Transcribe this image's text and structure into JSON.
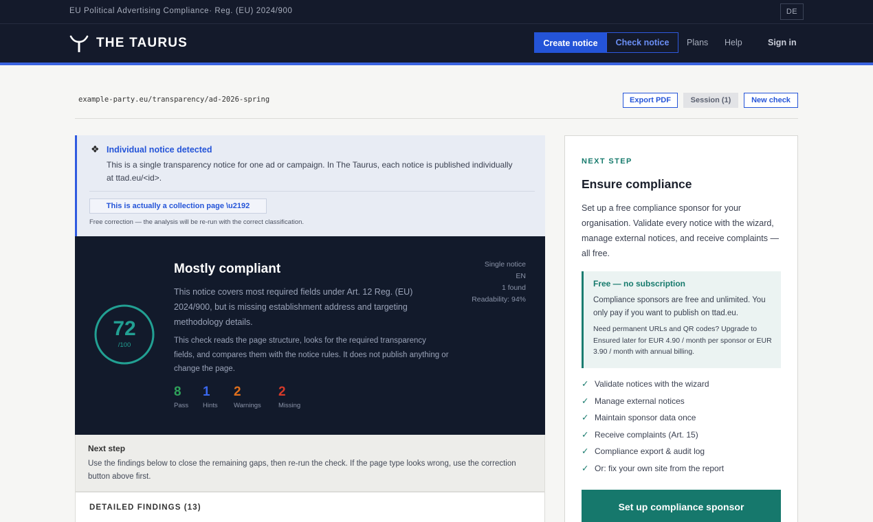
{
  "topbar": {
    "regulation_text": "EU Political Advertising Compliance· Reg. (EU) 2024/900",
    "language": "DE"
  },
  "header": {
    "brand": "THE TAURUS",
    "logo_icon": "taurus-horns-icon",
    "create_notice": "Create notice",
    "check_notice": "Check notice",
    "nav": {
      "plans": "Plans",
      "help": "Help",
      "sign_in": "Sign in"
    },
    "accent_color": "#3a63e0"
  },
  "toolbar": {
    "url": "example-party.eu/transparency/ad-2026-spring",
    "export_pdf": "Export PDF",
    "session": "Session (1)",
    "new_check": "New check"
  },
  "detection": {
    "icon": "four-diamonds-icon",
    "title": "Individual notice detected",
    "description": "This is a single transparency notice for one ad or campaign. In The Taurus, each notice is published individually at ttad.eu/<id>.",
    "correction_button": "This is actually a collection page \\u2192",
    "correction_note": "Free correction — the analysis will be re-run with the correct classification."
  },
  "score": {
    "value": "72",
    "max": "/100",
    "fraction": 0.72,
    "color": "#22a093",
    "heading": "Mostly compliant",
    "summary": "This notice covers most required fields under Art. 12 Reg. (EU) 2024/900, but is missing establishment address and targeting methodology details.",
    "explanation": "This check reads the page structure, looks for the required transparency fields, and compares them with the notice rules. It does not publish anything or change the page.",
    "meta": {
      "type": "Single notice",
      "language": "EN",
      "found": "1 found",
      "readability": "Readability: 94%"
    },
    "stats": {
      "pass": {
        "value": "8",
        "label": "Pass"
      },
      "hints": {
        "value": "1",
        "label": "Hints"
      },
      "warnings": {
        "value": "2",
        "label": "Warnings"
      },
      "missing": {
        "value": "2",
        "label": "Missing"
      }
    }
  },
  "next_step_left": {
    "title": "Next step",
    "description": "Use the findings below to close the remaining gaps, then re-run the check. If the page type looks wrong, use the correction button above first."
  },
  "findings": {
    "title": "DETAILED FINDINGS (13)"
  },
  "sidebar": {
    "kicker": "NEXT STEP",
    "title": "Ensure compliance",
    "intro": "Set up a free compliance sponsor for your organisation. Validate every notice with the wizard, manage external notices, and receive complaints — all free.",
    "free_box": {
      "title": "Free — no subscription",
      "p1": "Compliance sponsors are free and unlimited. You only pay if you want to publish on ttad.eu.",
      "p2": "Need permanent URLs and QR codes? Upgrade to Ensured later for EUR 4.90 / month per sponsor or EUR 3.90 / month with annual billing."
    },
    "checklist": [
      "Validate notices with the wizard",
      "Manage external notices",
      "Maintain sponsor data once",
      "Receive complaints (Art. 15)",
      "Compliance export & audit log",
      "Or: fix your own site from the report"
    ],
    "check_icon": "checkmark-icon",
    "cta": "Set up compliance sponsor",
    "cta_color": "#16786c"
  }
}
